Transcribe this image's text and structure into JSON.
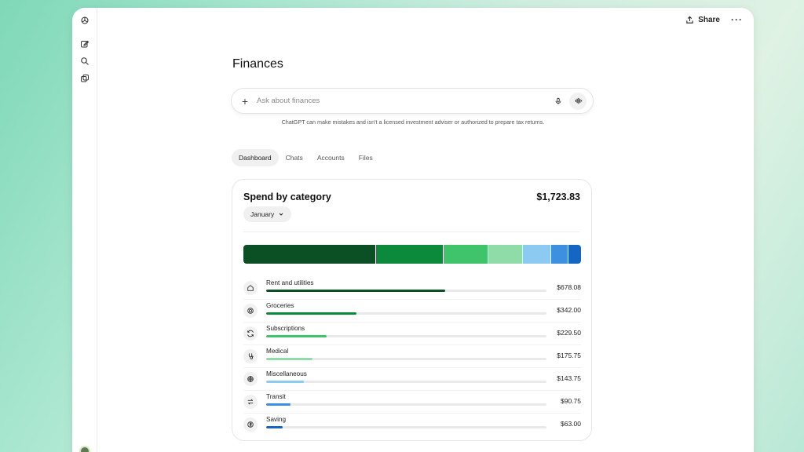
{
  "topbar": {
    "share_label": "Share"
  },
  "page": {
    "title": "Finances"
  },
  "ask": {
    "placeholder": "Ask about finances",
    "disclaimer": "ChatGPT can make mistakes and isn't a licensed investment adviser or authorized to prepare tax returns."
  },
  "tabs": [
    {
      "label": "Dashboard",
      "active": true
    },
    {
      "label": "Chats",
      "active": false
    },
    {
      "label": "Accounts",
      "active": false
    },
    {
      "label": "Files",
      "active": false
    }
  ],
  "card": {
    "title": "Spend by category",
    "total": "$1,723.83",
    "month": "January"
  },
  "categories": [
    {
      "label": "Rent and utilities",
      "amount": "$678.08",
      "value": 678.08,
      "color": "#0b4f25",
      "icon": "home-icon"
    },
    {
      "label": "Groceries",
      "amount": "$342.00",
      "value": 342.0,
      "color": "#0a8a3a",
      "icon": "groceries-icon"
    },
    {
      "label": "Subscriptions",
      "amount": "$229.50",
      "value": 229.5,
      "color": "#3fc46c",
      "icon": "refresh-icon"
    },
    {
      "label": "Medical",
      "amount": "$175.75",
      "value": 175.75,
      "color": "#8fdca8",
      "icon": "medical-icon"
    },
    {
      "label": "Miscellaneous",
      "amount": "$143.75",
      "value": 143.75,
      "color": "#8ccaf2",
      "icon": "globe-icon"
    },
    {
      "label": "Transit",
      "amount": "$90.75",
      "value": 90.75,
      "color": "#3d8fe0",
      "icon": "transfer-icon"
    },
    {
      "label": "Saving",
      "amount": "$63.00",
      "value": 63.0,
      "color": "#1566c2",
      "icon": "dollar-icon"
    }
  ],
  "bar_max_value": 1062
}
